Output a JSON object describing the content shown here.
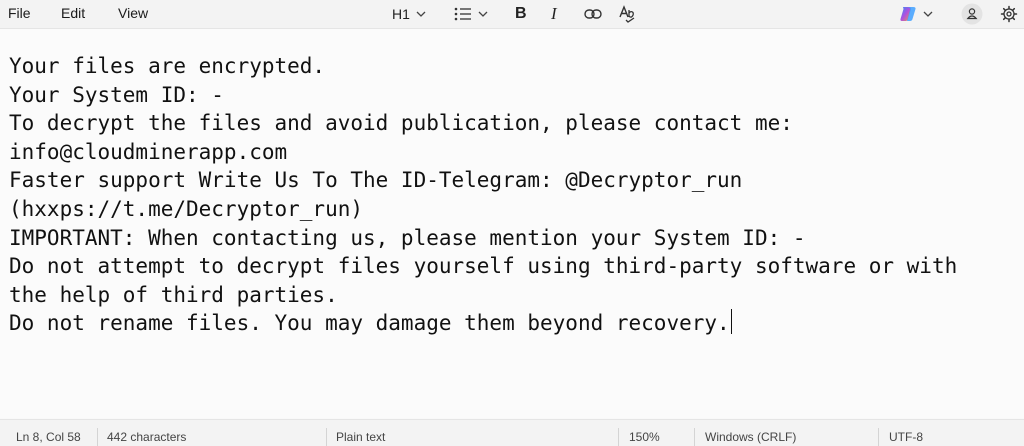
{
  "menu": {
    "file": "File",
    "edit": "Edit",
    "view": "View"
  },
  "toolbar": {
    "heading_label": "H1",
    "icons": [
      "chevron-down-icon",
      "list-icon",
      "bold-icon",
      "italic-icon",
      "link-icon",
      "spellcheck-icon",
      "copilot-icon",
      "account-icon",
      "settings-icon"
    ],
    "bold_label": "B",
    "italic_label": "I"
  },
  "document": {
    "lines": [
      "Your files are encrypted.",
      "Your System ID: -",
      "To decrypt the files and avoid publication, please contact me:",
      "info@cloudminerapp.com",
      "Faster support Write Us To The ID-Telegram: @Decryptor_run",
      "(hxxps://t.me/Decryptor_run)",
      "IMPORTANT: When contacting us, please mention your System ID: -",
      "Do not attempt to decrypt files yourself using third-party software or with",
      "the help of third parties.",
      "Do not rename files. You may damage them beyond recovery."
    ]
  },
  "status": {
    "position": "Ln 8, Col 58",
    "characters": "442 characters",
    "format": "Plain text",
    "zoom": "150%",
    "line_ending": "Windows (CRLF)",
    "encoding": "UTF-8"
  }
}
